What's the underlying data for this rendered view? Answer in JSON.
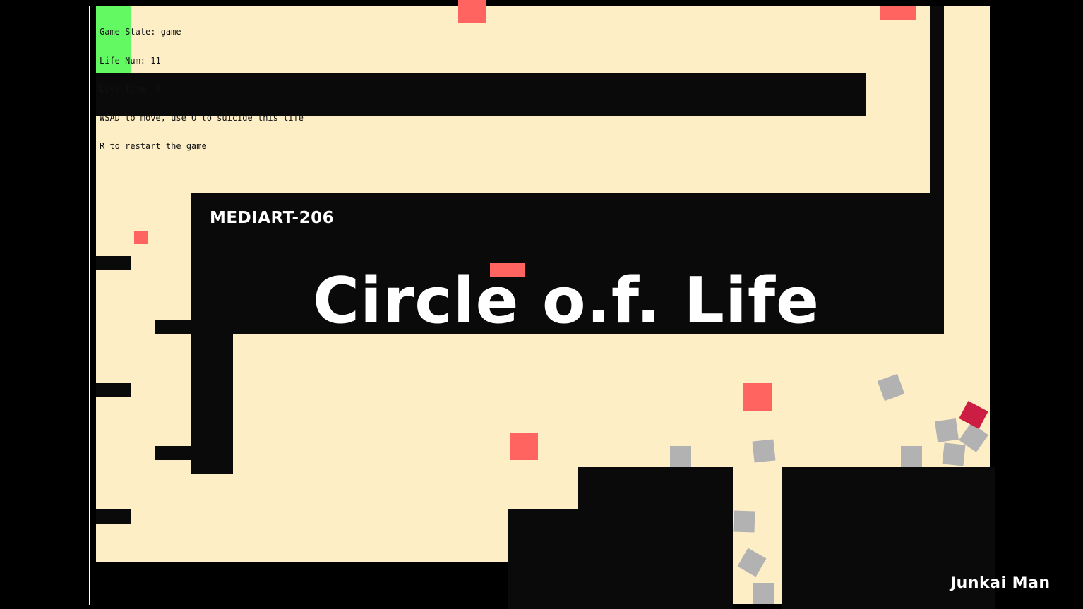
{
  "hud": {
    "game_state": "Game State: game",
    "life_num": "Life Num: 11",
    "live_time": "Live Time: 2",
    "controls_hint": "WSAD to move, use O to suicide this life",
    "restart_hint": "R to restart the game"
  },
  "overlay": {
    "course_label": "MEDIART-206",
    "title": "Circle o.f. Life",
    "author": "Junkai Man"
  },
  "colors": {
    "floor": "#fdeec6",
    "wall": "#0a0a0a",
    "hazard": "#ff6461",
    "spawn": "#62f962",
    "corpse": "#b2b2b2",
    "player": "#cc1e42"
  },
  "icons": {
    "spawn": "green-square",
    "hazard": "red-square",
    "corpse": "gray-square",
    "player": "crimson-square"
  }
}
